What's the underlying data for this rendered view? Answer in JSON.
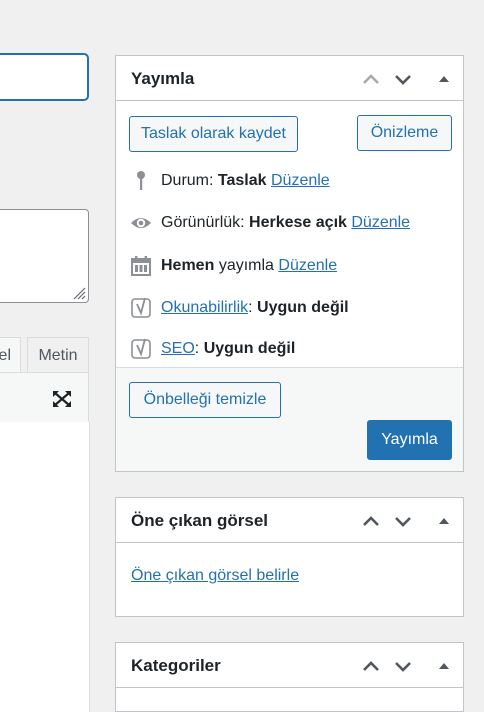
{
  "left": {
    "tabs": {
      "partial_label": "el",
      "text_label": "Metin"
    }
  },
  "publish": {
    "title": "Yayımla",
    "save_draft": "Taslak olarak kaydet",
    "preview": "Önizleme",
    "status": {
      "label": "Durum:",
      "value": "Taslak",
      "edit": "Düzenle"
    },
    "visibility": {
      "label": "Görünürlük:",
      "value": "Herkese açık",
      "edit": "Düzenle"
    },
    "schedule": {
      "value": "Hemen",
      "label": "yayımla",
      "edit": "Düzenle"
    },
    "readability": {
      "link": "Okunabilirlik",
      "sep": ":",
      "value": "Uygun değil"
    },
    "seo": {
      "link": "SEO",
      "sep": ":",
      "value": "Uygun değil"
    },
    "clear_cache": "Önbelleği temizle",
    "publish_button": "Yayımla"
  },
  "featured_image": {
    "title": "Öne çıkan görsel",
    "set_link": "Öne çıkan görsel belirle"
  },
  "categories": {
    "title": "Kategoriler"
  },
  "colors": {
    "accent": "#2271b1",
    "border": "#c3c4c7",
    "background": "#f0f0f1"
  }
}
